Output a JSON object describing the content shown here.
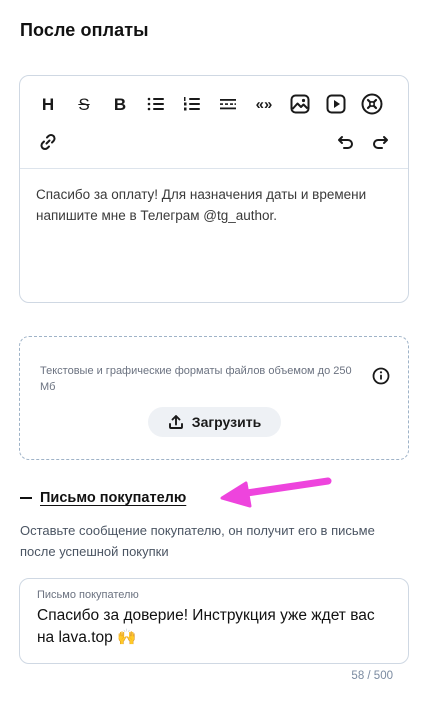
{
  "page": {
    "title": "После оплаты"
  },
  "editor": {
    "toolbar": {
      "heading_label": "H",
      "strike_label": "S",
      "bold_label": "B",
      "quote_label": "«»"
    },
    "content": "Спасибо за оплату! Для назначения даты и времени напишите мне в Телеграм @tg_author."
  },
  "upload": {
    "hint": "Текстовые и графические форматы файлов объемом до 250 Мб",
    "button_label": "Загрузить"
  },
  "letter": {
    "section_title": "Письмо покупателю",
    "description": "Оставьте сообщение покупателю, он получит его в письме после успешной покупки",
    "field_label": "Письмо покупателю",
    "field_value": "Спасибо за доверие! Инструкция уже ждет вас на lava.top 🙌",
    "counter": "58 / 500"
  },
  "colors": {
    "border": "#cfd8e3",
    "annotation_arrow": "#ee44dd",
    "muted_text": "#6b7280"
  },
  "icons": [
    "bullet-list-icon",
    "numbered-list-icon",
    "divider-icon",
    "image-icon",
    "video-icon",
    "no-embed-icon",
    "link-icon",
    "undo-icon",
    "redo-icon",
    "info-icon",
    "upload-icon",
    "collapse-minus-icon",
    "annotation-arrow"
  ]
}
